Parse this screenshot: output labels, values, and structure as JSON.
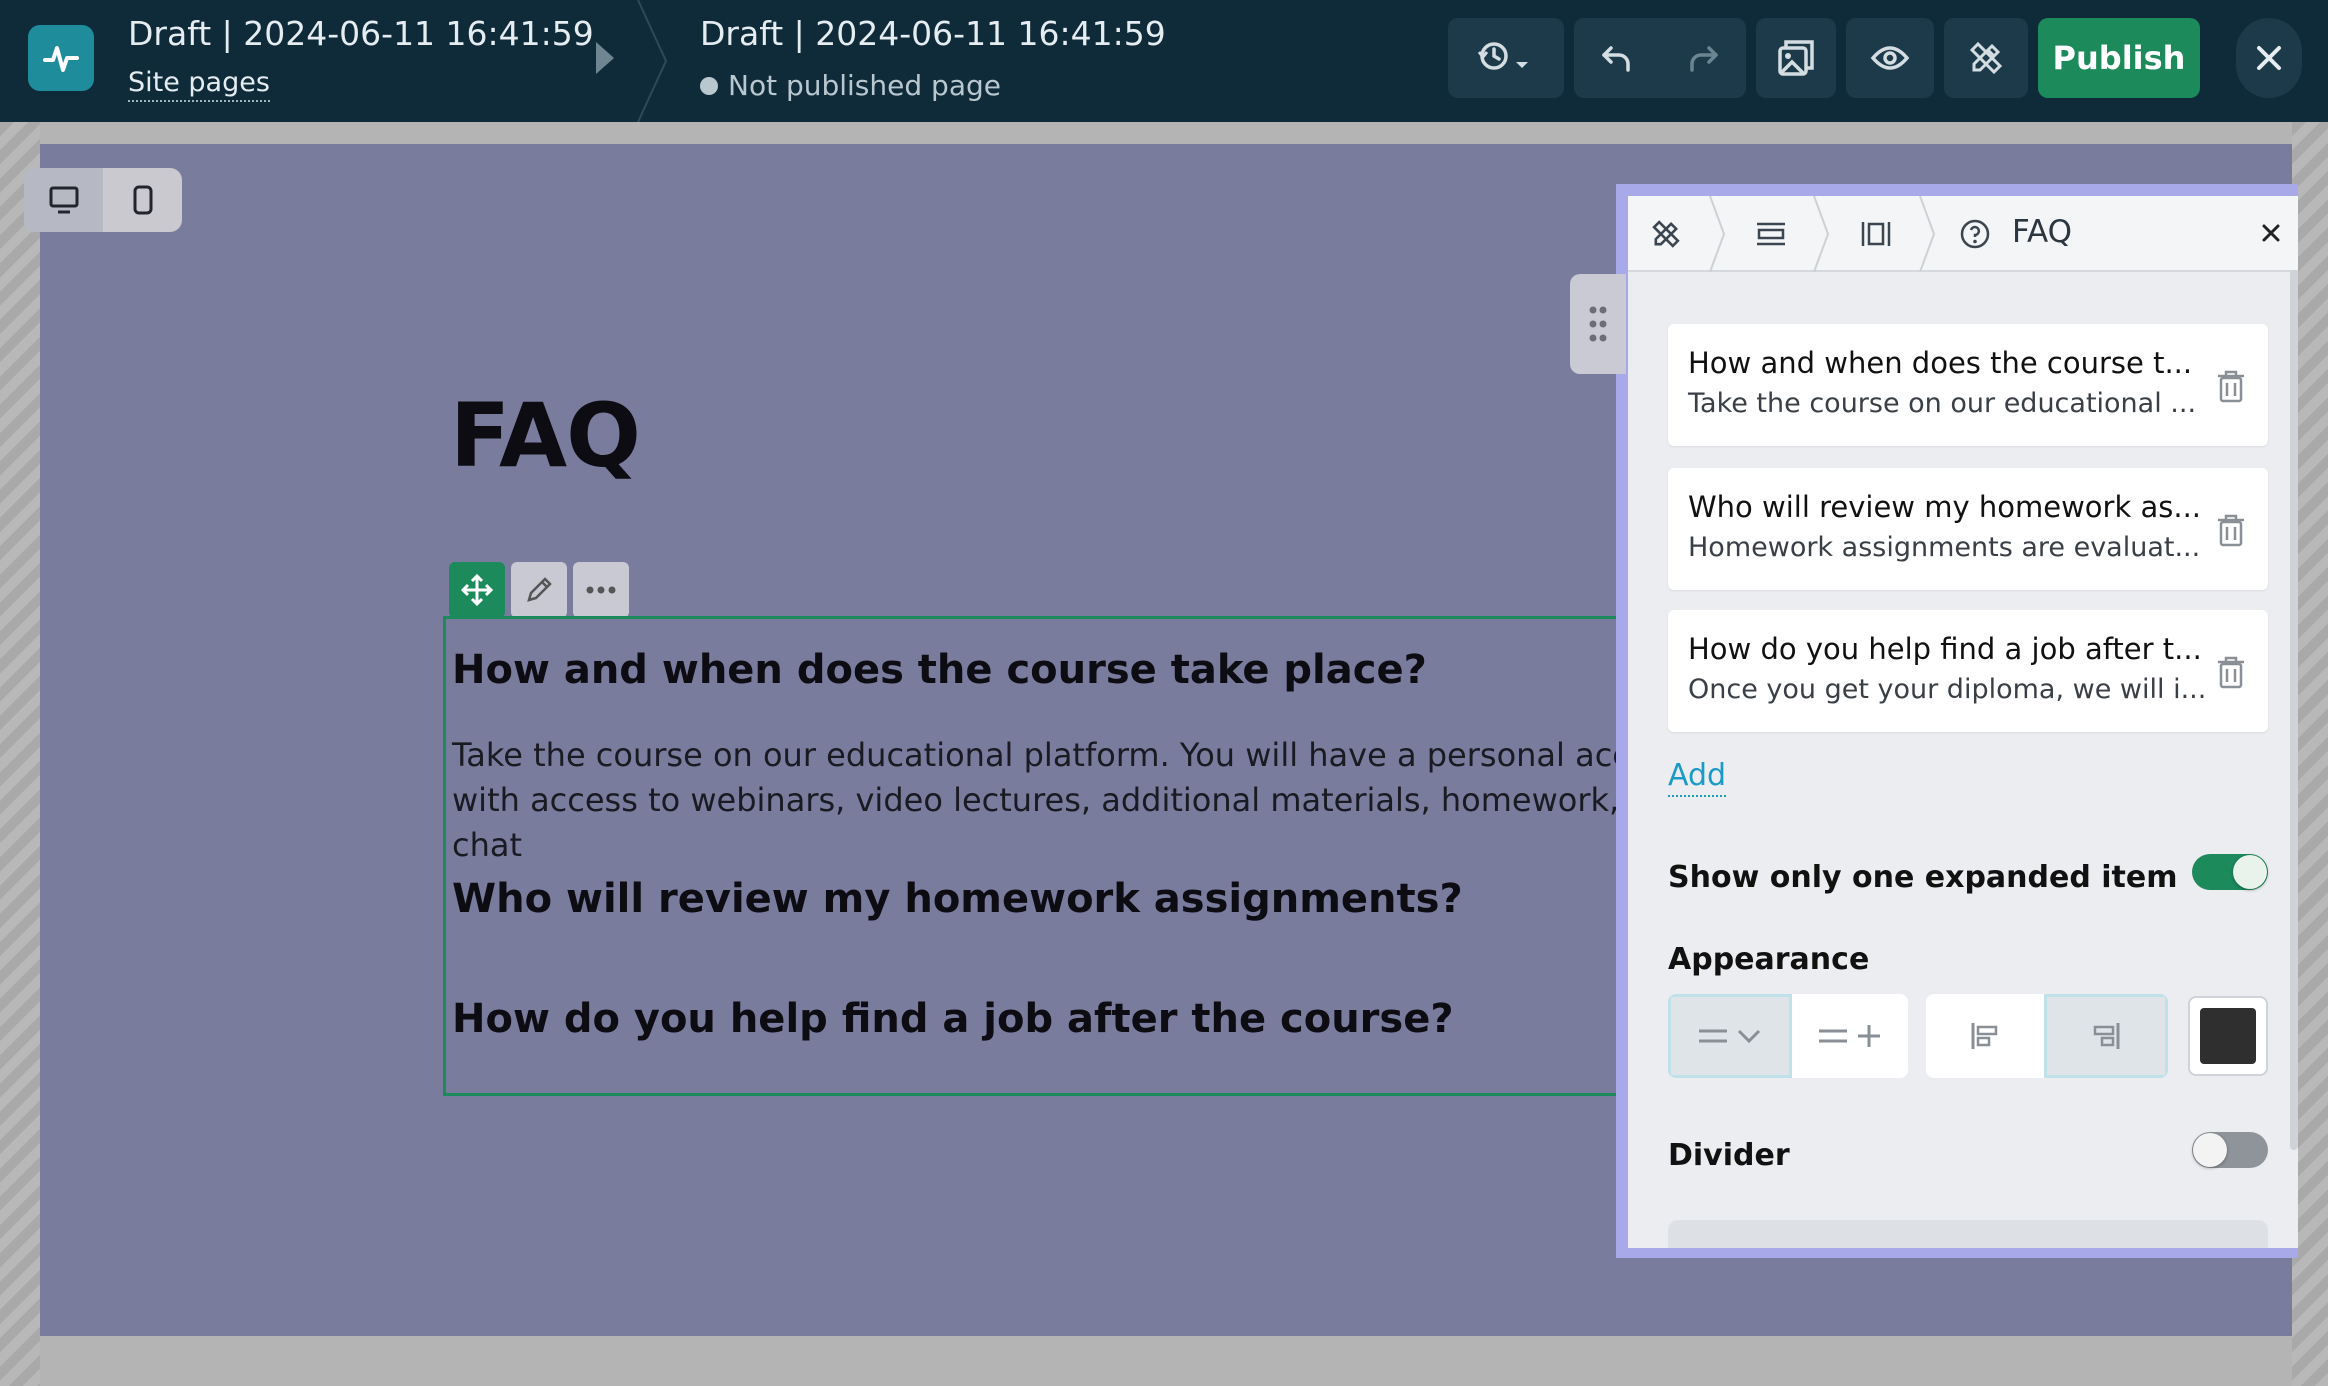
{
  "header": {
    "site_title": "Draft | 2024-06-11 16:41:59",
    "site_link": "Site pages",
    "page_title": "Draft | 2024-06-11 16:41:59",
    "page_status": "Not published page",
    "publish_label": "Publish",
    "icons": [
      "pulse-logo-icon",
      "history-icon",
      "undo-icon",
      "redo-icon",
      "gallery-icon",
      "eye-icon",
      "design-tools-icon",
      "close-icon"
    ]
  },
  "device_toggle": {
    "options": [
      "desktop-icon",
      "mobile-icon"
    ],
    "selected": "desktop"
  },
  "canvas": {
    "heading": "FAQ",
    "items": [
      {
        "question": "How and when does the course take place?",
        "answer": "Take the course on our educational platform. You will have a personal account with access to webinars, video lectures, additional materials, homework, and chat"
      },
      {
        "question": "Who will review my homework assignments?"
      },
      {
        "question": "How do you help find a job after the course?"
      }
    ]
  },
  "panel": {
    "title": "FAQ",
    "items": [
      {
        "title": "How and when does the course t...",
        "subtitle": "Take the course on our educational ..."
      },
      {
        "title": "Who will review my homework as...",
        "subtitle": "Homework assignments are evaluat..."
      },
      {
        "title": "How do you help find a job after t...",
        "subtitle": "Once you get your diploma, we will i..."
      }
    ],
    "add_label": "Add",
    "show_one_label": "Show only one expanded item",
    "show_one_enabled": true,
    "appearance_label": "Appearance",
    "appearance_icon_style": "chevron",
    "appearance_alignment": "right",
    "appearance_color": "#2f2f2f",
    "divider_label": "Divider",
    "divider_enabled": false
  },
  "colors": {
    "topbar": "#0f2b3a",
    "accent": "#1c8a5a",
    "canvas": "#7a7c9e",
    "link": "#1b9ac8"
  }
}
